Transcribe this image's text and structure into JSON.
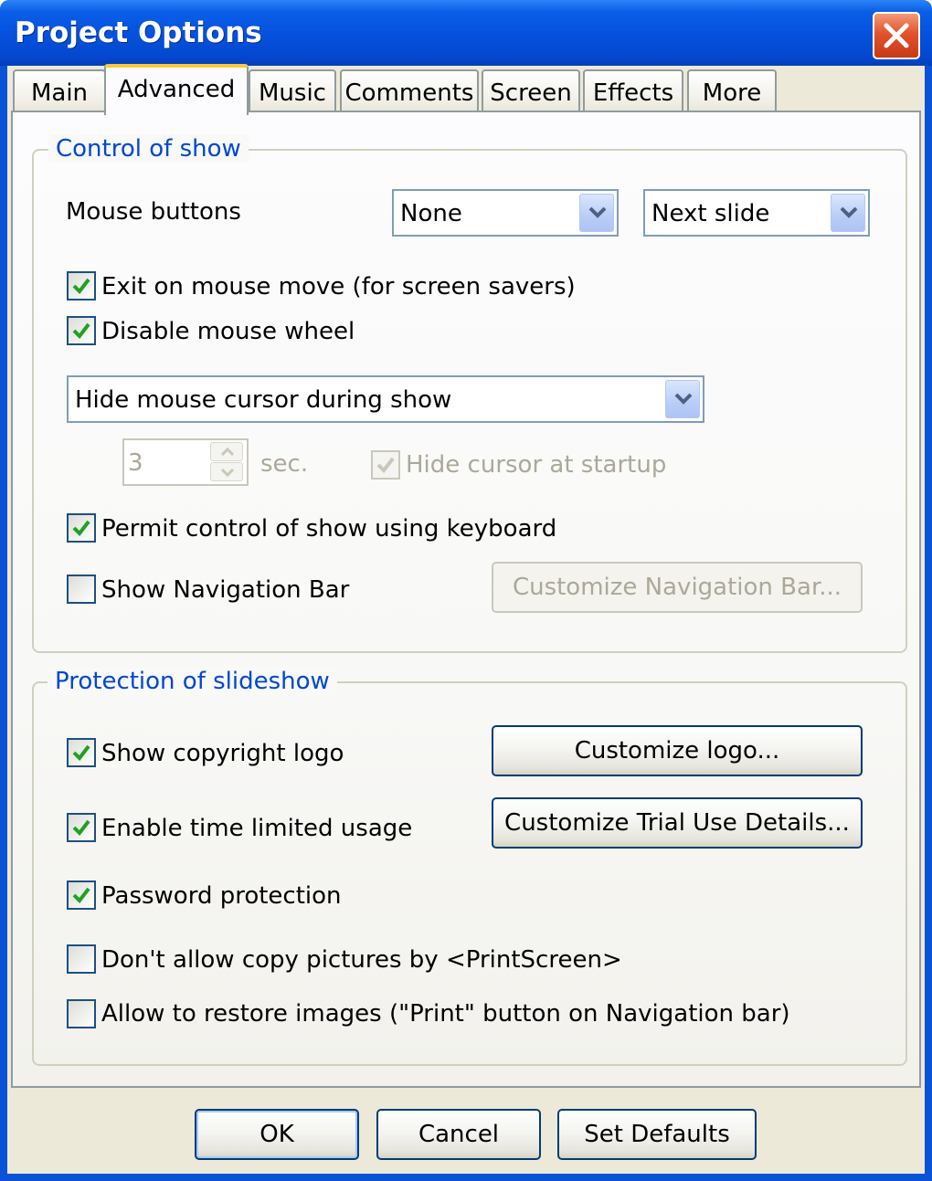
{
  "window": {
    "title": "Project Options"
  },
  "tabs": [
    {
      "label": "Main"
    },
    {
      "label": "Advanced"
    },
    {
      "label": "Music"
    },
    {
      "label": "Comments"
    },
    {
      "label": "Screen"
    },
    {
      "label": "Effects"
    },
    {
      "label": "More"
    }
  ],
  "active_tab": "Advanced",
  "control_group": {
    "title": "Control of show",
    "mouse_buttons_label": "Mouse buttons",
    "mouse_left_value": "None",
    "mouse_right_value": "Next slide",
    "exit_on_mouse_move": {
      "label": "Exit on mouse move (for screen savers)",
      "checked": true
    },
    "disable_mouse_wheel": {
      "label": "Disable mouse wheel",
      "checked": true
    },
    "cursor_mode_value": "Hide mouse cursor during show",
    "seconds_value": "3",
    "seconds_unit": "sec.",
    "hide_cursor_at_startup": {
      "label": "Hide cursor at startup",
      "checked": true,
      "enabled": false
    },
    "permit_keyboard": {
      "label": "Permit control of show using keyboard",
      "checked": true
    },
    "show_navigation_bar": {
      "label": "Show Navigation Bar",
      "checked": false
    },
    "customize_nav_button": "Customize Navigation Bar..."
  },
  "protection_group": {
    "title": "Protection of slideshow",
    "show_copyright_logo": {
      "label": "Show copyright logo",
      "checked": true
    },
    "customize_logo_button": "Customize logo...",
    "enable_time_limited": {
      "label": "Enable time limited usage",
      "checked": true
    },
    "customize_trial_button": "Customize Trial Use Details...",
    "password_protection": {
      "label": "Password protection",
      "checked": true
    },
    "password_value": "",
    "no_printscreen": {
      "label": "Don't allow copy pictures by <PrintScreen>",
      "checked": false
    },
    "allow_restore_images": {
      "label": "Allow to restore images (\"Print\" button on Navigation bar)",
      "checked": false
    }
  },
  "footer": {
    "ok": "OK",
    "cancel": "Cancel",
    "set_defaults": "Set Defaults"
  },
  "colors": {
    "title_bar": "#0a52d6",
    "group_label": "#0046d5",
    "active_tab_accent": "#ffc83c",
    "close_button": "#e2522d"
  }
}
